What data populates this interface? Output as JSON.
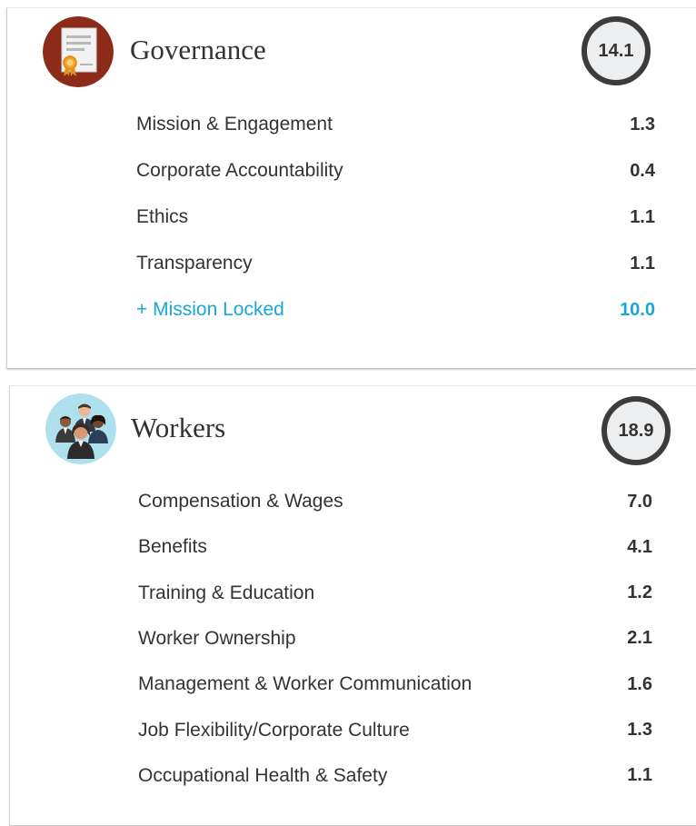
{
  "colors": {
    "text": "#333333",
    "accent": "#1aa7d8",
    "score_ring": "#3c3c3c",
    "score_fill": "#eceef0",
    "governance_icon_bg": "#8c2b19",
    "workers_icon_bg": "#aee0ee"
  },
  "governance": {
    "icon": "certificate-document-icon",
    "title": "Governance",
    "score": "14.1",
    "items": [
      {
        "label": "Mission & Engagement",
        "value": "1.3"
      },
      {
        "label": "Corporate Accountability",
        "value": "0.4"
      },
      {
        "label": "Ethics",
        "value": "1.1"
      },
      {
        "label": "Transparency",
        "value": "1.1"
      },
      {
        "label": "+ Mission Locked",
        "value": "10.0",
        "accent": true
      }
    ]
  },
  "workers": {
    "icon": "people-group-icon",
    "title": "Workers",
    "score": "18.9",
    "items": [
      {
        "label": "Compensation & Wages",
        "value": "7.0"
      },
      {
        "label": "Benefits",
        "value": "4.1"
      },
      {
        "label": "Training & Education",
        "value": "1.2"
      },
      {
        "label": "Worker Ownership",
        "value": "2.1"
      },
      {
        "label": "Management & Worker Communication",
        "value": "1.6"
      },
      {
        "label": "Job Flexibility/Corporate Culture",
        "value": "1.3"
      },
      {
        "label": "Occupational Health & Safety",
        "value": "1.1"
      }
    ]
  }
}
